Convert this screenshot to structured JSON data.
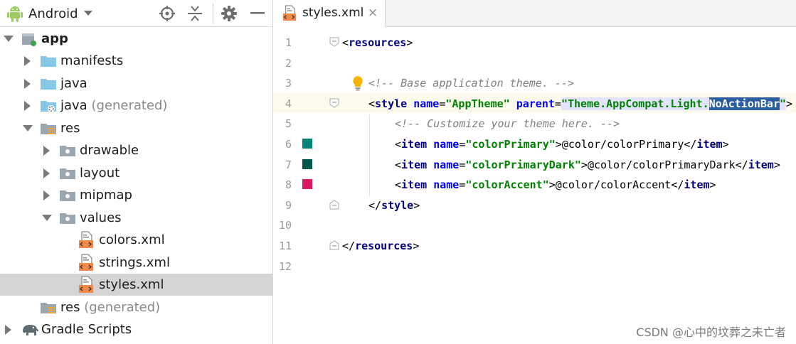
{
  "project_panel": {
    "view_selector_label": "Android",
    "toolbar_icons": [
      "locate-icon",
      "collapse-all-icon",
      "gear-icon",
      "hide-icon"
    ],
    "tree": [
      {
        "label": "app",
        "suffix": "",
        "depth": 0,
        "expanded": true,
        "icon": "module-icon"
      },
      {
        "label": "manifests",
        "suffix": "",
        "depth": 1,
        "expanded": false,
        "icon": "folder-icon"
      },
      {
        "label": "java",
        "suffix": "",
        "depth": 1,
        "expanded": false,
        "icon": "folder-icon"
      },
      {
        "label": "java",
        "suffix": " (generated)",
        "depth": 1,
        "expanded": false,
        "icon": "generated-folder-icon"
      },
      {
        "label": "res",
        "suffix": "",
        "depth": 1,
        "expanded": true,
        "icon": "res-folder-icon"
      },
      {
        "label": "drawable",
        "suffix": "",
        "depth": 2,
        "expanded": false,
        "icon": "res-subfolder-icon"
      },
      {
        "label": "layout",
        "suffix": "",
        "depth": 2,
        "expanded": false,
        "icon": "res-subfolder-icon"
      },
      {
        "label": "mipmap",
        "suffix": "",
        "depth": 2,
        "expanded": false,
        "icon": "res-subfolder-icon"
      },
      {
        "label": "values",
        "suffix": "",
        "depth": 2,
        "expanded": true,
        "icon": "res-subfolder-icon"
      },
      {
        "label": "colors.xml",
        "suffix": "",
        "depth": 3,
        "expanded": null,
        "icon": "xml-file-icon"
      },
      {
        "label": "strings.xml",
        "suffix": "",
        "depth": 3,
        "expanded": null,
        "icon": "xml-file-icon"
      },
      {
        "label": "styles.xml",
        "suffix": "",
        "depth": 3,
        "expanded": null,
        "icon": "xml-file-icon",
        "selected": true
      },
      {
        "label": "res",
        "suffix": " (generated)",
        "depth": 1,
        "expanded": null,
        "icon": "res-folder-icon"
      },
      {
        "label": "Gradle Scripts",
        "suffix": "",
        "depth": 0,
        "expanded": false,
        "icon": "gradle-elephant-icon"
      }
    ]
  },
  "editor": {
    "tab": {
      "label": "styles.xml",
      "close": "×"
    },
    "line_numbers": [
      "1",
      "2",
      "3",
      "4",
      "5",
      "6",
      "7",
      "8",
      "9",
      "10",
      "11",
      "12"
    ],
    "lines": {
      "l1": {
        "open": "<",
        "tag": "resources",
        "close": ">"
      },
      "l3": {
        "comment": "<!-- Base application theme. -->"
      },
      "l4": {
        "open": "<",
        "tag": "style",
        "attr1": "name",
        "eq1": "=",
        "val1": "\"AppTheme\"",
        "attr2": "parent",
        "eq2": "=",
        "val2_q": "\"",
        "val2_a": "Theme.AppCompat.Light.",
        "val2_sel": "NoActionBar",
        "val2_q2": "\"",
        "close": ">"
      },
      "l5": {
        "comment": "<!-- Customize your theme here. -->"
      },
      "l6": {
        "open": "<",
        "tag": "item",
        "attr": "name",
        "eq": "=",
        "val": "\"colorPrimary\"",
        "close": ">",
        "text": "@color/colorPrimary",
        "end_open": "</",
        "end_tag": "item",
        "end_close": ">"
      },
      "l7": {
        "open": "<",
        "tag": "item",
        "attr": "name",
        "eq": "=",
        "val": "\"colorPrimaryDark\"",
        "close": ">",
        "text": "@color/colorPrimaryDark",
        "end_open": "</",
        "end_tag": "item",
        "end_close": ">"
      },
      "l8": {
        "open": "<",
        "tag": "item",
        "attr": "name",
        "eq": "=",
        "val": "\"colorAccent\"",
        "close": ">",
        "text": "@color/colorAccent",
        "end_open": "</",
        "end_tag": "item",
        "end_close": ">"
      },
      "l9": {
        "open": "</",
        "tag": "style",
        "close": ">"
      },
      "l11": {
        "open": "</",
        "tag": "resources",
        "close": ">"
      }
    },
    "swatch_colors": {
      "colorPrimary": "#008577",
      "colorPrimaryDark": "#00574B",
      "colorAccent": "#D81B60"
    }
  },
  "watermark": "CSDN @心中的坟葬之未亡者"
}
